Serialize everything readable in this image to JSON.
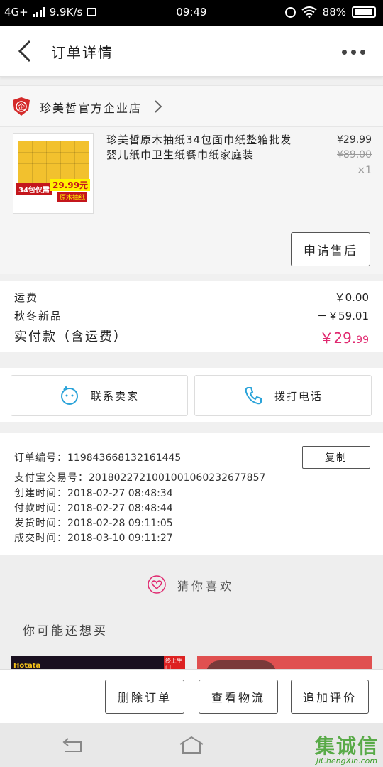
{
  "status_bar": {
    "network": "4G+",
    "speed": "9.9K/s",
    "time": "09:49",
    "battery": "88%"
  },
  "header": {
    "title": "订单详情"
  },
  "shop": {
    "name": "珍美皙官方企业店",
    "logo_char": "企"
  },
  "product": {
    "name": "珍美皙原木抽纸34包面巾纸整箱批发婴儿纸巾卫生纸餐巾纸家庭装",
    "price": "¥29.99",
    "original_price": "¥89.00",
    "quantity": "×1",
    "thumb_badge_packs": "34包仅需",
    "thumb_badge_price": "29.99元",
    "thumb_badge_type": "原木抽纸",
    "after_sale_label": "申请售后"
  },
  "costs": {
    "shipping_label": "运费",
    "shipping_value": "￥0.00",
    "promo_label": "秋冬新品",
    "promo_value": "－￥59.01",
    "paid_label": "实付款（含运费）",
    "paid_value_main": "￥29.",
    "paid_value_cents": "99"
  },
  "contact": {
    "seller_label": "联系卖家",
    "call_label": "拨打电话"
  },
  "order_info": {
    "copy_label": "复制",
    "rows": [
      {
        "key": "订单编号：",
        "value": "119843668132161445"
      },
      {
        "key": "支付宝交易号：",
        "value": "2018022721001001060232677857"
      },
      {
        "key": "创建时间：",
        "value": "2018-02-27 08:48:34"
      },
      {
        "key": "付款时间：",
        "value": "2018-02-27 08:48:44"
      },
      {
        "key": "发货时间：",
        "value": "2018-02-28 09:11:05"
      },
      {
        "key": "成交时间：",
        "value": "2018-03-10 09:11:27"
      }
    ]
  },
  "recommend": {
    "title": "猜你喜欢",
    "subtitle": "你可能还想买",
    "item1_brand": "Hotata",
    "item1_tag": "终上生门"
  },
  "actions": {
    "delete_label": "删除订单",
    "logistics_label": "查看物流",
    "review_label": "追加评价"
  },
  "watermark": {
    "chars": "集诚信",
    "site": "JiChengXin.com"
  },
  "colors": {
    "accent_pink": "#e0286f",
    "shop_logo_red": "#d42b2b",
    "icon_blue": "#2aa3d9"
  }
}
